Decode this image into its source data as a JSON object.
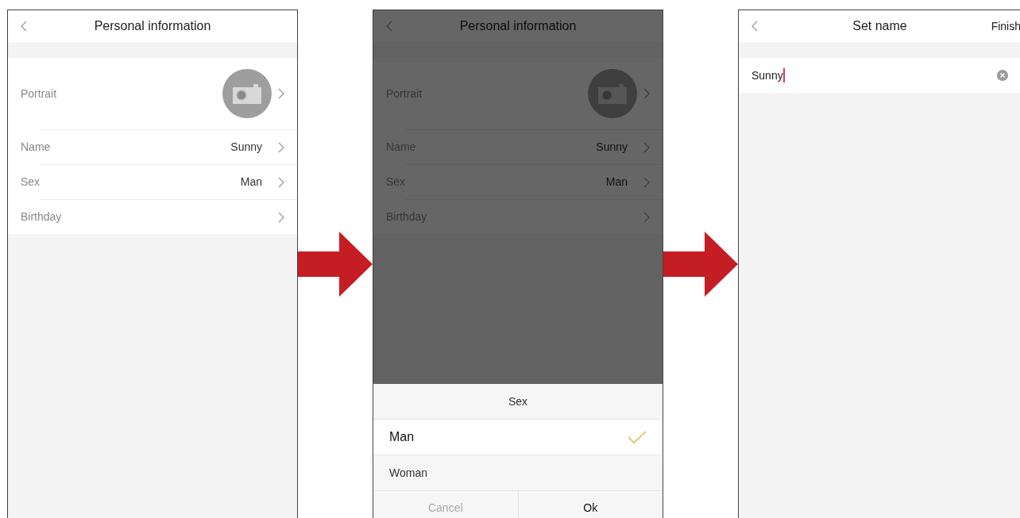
{
  "screens": [
    {
      "kind": "profile",
      "title": "Personal information",
      "dimmed": false,
      "rows": [
        {
          "kind": "portrait",
          "label": "Portrait"
        },
        {
          "kind": "text",
          "label": "Name",
          "value": "Sunny"
        },
        {
          "kind": "text",
          "label": "Sex",
          "value": "Man"
        },
        {
          "kind": "text",
          "label": "Birthday"
        }
      ]
    },
    {
      "kind": "profile",
      "title": "Personal information",
      "dimmed": true,
      "rows": [
        {
          "kind": "portrait",
          "label": "Portrait"
        },
        {
          "kind": "text",
          "label": "Name",
          "value": "Sunny"
        },
        {
          "kind": "text",
          "label": "Sex",
          "value": "Man"
        },
        {
          "kind": "text",
          "label": "Birthday"
        }
      ],
      "sheet": {
        "title": "Sex",
        "options": [
          {
            "label": "Man",
            "selected": true
          },
          {
            "label": "Woman",
            "selected": false
          }
        ],
        "buttons": [
          {
            "label": "Cancel",
            "disabled": true
          },
          {
            "label": "Ok",
            "disabled": false
          }
        ]
      }
    },
    {
      "kind": "edit",
      "title": "Set name",
      "action": "Finish",
      "field": {
        "value": "Sunny"
      }
    }
  ]
}
